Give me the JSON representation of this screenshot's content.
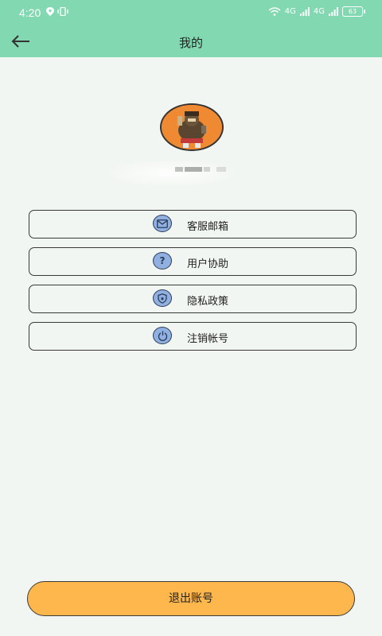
{
  "status_bar": {
    "time": "4:20",
    "network_1": "4G",
    "network_2": "4G",
    "battery": "63"
  },
  "header": {
    "title": "我的"
  },
  "menu": {
    "items": [
      {
        "label": "客服邮箱",
        "icon": "mail-icon"
      },
      {
        "label": "用户协助",
        "icon": "help-icon"
      },
      {
        "label": "隐私政策",
        "icon": "shield-icon"
      },
      {
        "label": "注销帐号",
        "icon": "power-icon"
      }
    ]
  },
  "logout": {
    "label": "退出账号"
  },
  "colors": {
    "header_bg": "#82d8b1",
    "page_bg": "#f2f6f2",
    "logout_bg": "#fdb74c",
    "icon_bg": "#8fb0e0"
  }
}
